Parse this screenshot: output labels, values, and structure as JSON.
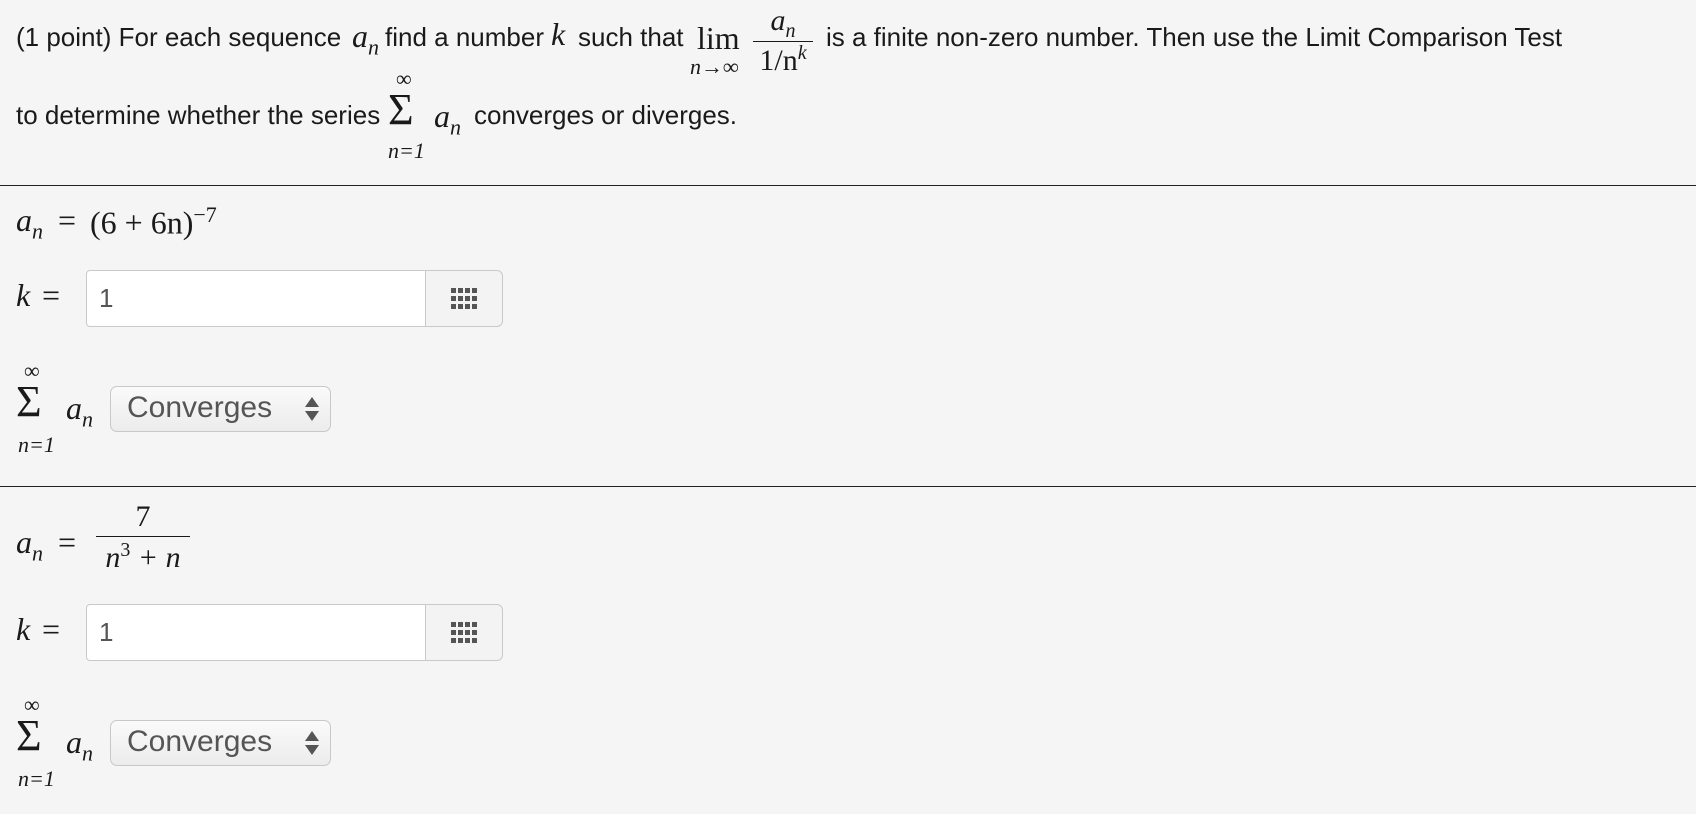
{
  "header": {
    "intro": "(1 point) For each sequence",
    "seq_symbol": "a",
    "seq_sub": "n",
    "find_text": "find a number",
    "k_symbol": "k",
    "such_that": "such that",
    "lim_word": "lim",
    "lim_sub": "n→∞",
    "frac_num": "a",
    "frac_num_sub": "n",
    "frac_den": "1/n",
    "frac_den_sup": "k",
    "after_limit": "is a finite non-zero number. Then use the Limit Comparison Test",
    "line2_start": "to determine whether the series",
    "sigma_top": "∞",
    "sigma_bottom": "n=1",
    "series_term": "a",
    "series_term_sub": "n",
    "line2_end": "converges or diverges."
  },
  "parts": [
    {
      "an_label": "a",
      "an_sub": "n",
      "equals": "=",
      "formula_base": "(6 + 6n)",
      "formula_exp": "−7",
      "k_label": "k",
      "k_equals": "=",
      "k_value": "1",
      "sum_top": "∞",
      "sum_bottom": "n=1",
      "sum_term": "a",
      "sum_term_sub": "n",
      "selected": "Converges"
    },
    {
      "an_label": "a",
      "an_sub": "n",
      "equals": "=",
      "frac_num": "7",
      "frac_den_base": "n",
      "frac_den_exp": "3",
      "frac_den_rest": " + n",
      "k_label": "k",
      "k_equals": "=",
      "k_value": "1",
      "sum_top": "∞",
      "sum_bottom": "n=1",
      "sum_term": "a",
      "sum_term_sub": "n",
      "selected": "Converges"
    }
  ],
  "icons": {
    "palette": "grid-icon",
    "select": "up-down-arrows-icon"
  }
}
